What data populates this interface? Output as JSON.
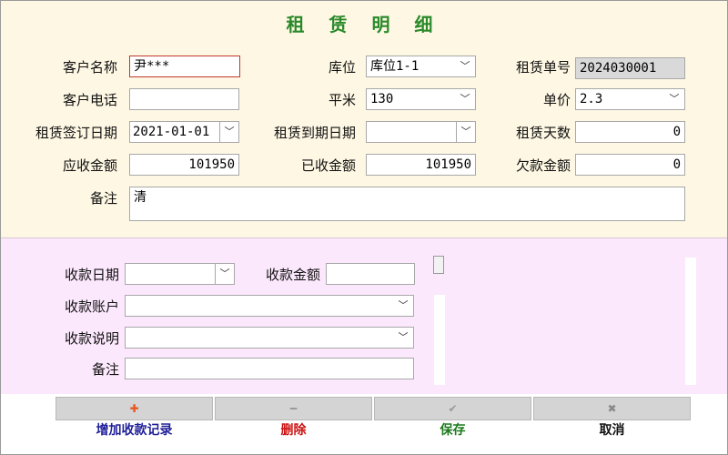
{
  "title": "租 赁 明 细",
  "fields": {
    "customer_name": {
      "label": "客户名称",
      "value": "尹***"
    },
    "customer_phone": {
      "label": "客户电话",
      "value": ""
    },
    "sign_date": {
      "label": "租赁签订日期",
      "value": "2021-01-01"
    },
    "receivable": {
      "label": "应收金额",
      "value": "101950"
    },
    "remark": {
      "label": "备注",
      "value": "清"
    },
    "location": {
      "label": "库位",
      "value": "库位1-1"
    },
    "area": {
      "label": "平米",
      "value": "130"
    },
    "expire_date": {
      "label": "租赁到期日期",
      "value": ""
    },
    "received": {
      "label": "已收金额",
      "value": "101950"
    },
    "order_no": {
      "label": "租赁单号",
      "value": "2024030001"
    },
    "unit_price": {
      "label": "单价",
      "value": "2.3"
    },
    "rent_days": {
      "label": "租赁天数",
      "value": "0"
    },
    "arrears": {
      "label": "欠款金额",
      "value": "0"
    }
  },
  "payment": {
    "date": {
      "label": "收款日期",
      "value": ""
    },
    "amount": {
      "label": "收款金额",
      "value": ""
    },
    "account": {
      "label": "收款账户",
      "value": ""
    },
    "description": {
      "label": "收款说明",
      "value": ""
    },
    "remark": {
      "label": "备注",
      "value": ""
    }
  },
  "buttons": {
    "add": {
      "icon": "✚",
      "label": "增加收款记录",
      "color": "#1f1f9a"
    },
    "delete": {
      "icon": "━",
      "label": "删除",
      "color": "#cc1111"
    },
    "save": {
      "icon": "✔",
      "label": "保存",
      "color": "#1e7a1e"
    },
    "cancel": {
      "icon": "✖",
      "label": "取消",
      "color": "#111111"
    }
  },
  "icons": {
    "dropdown": "chevron-down-icon",
    "add": "plus-icon",
    "delete": "minus-icon",
    "save": "check-icon",
    "cancel": "close-icon"
  }
}
